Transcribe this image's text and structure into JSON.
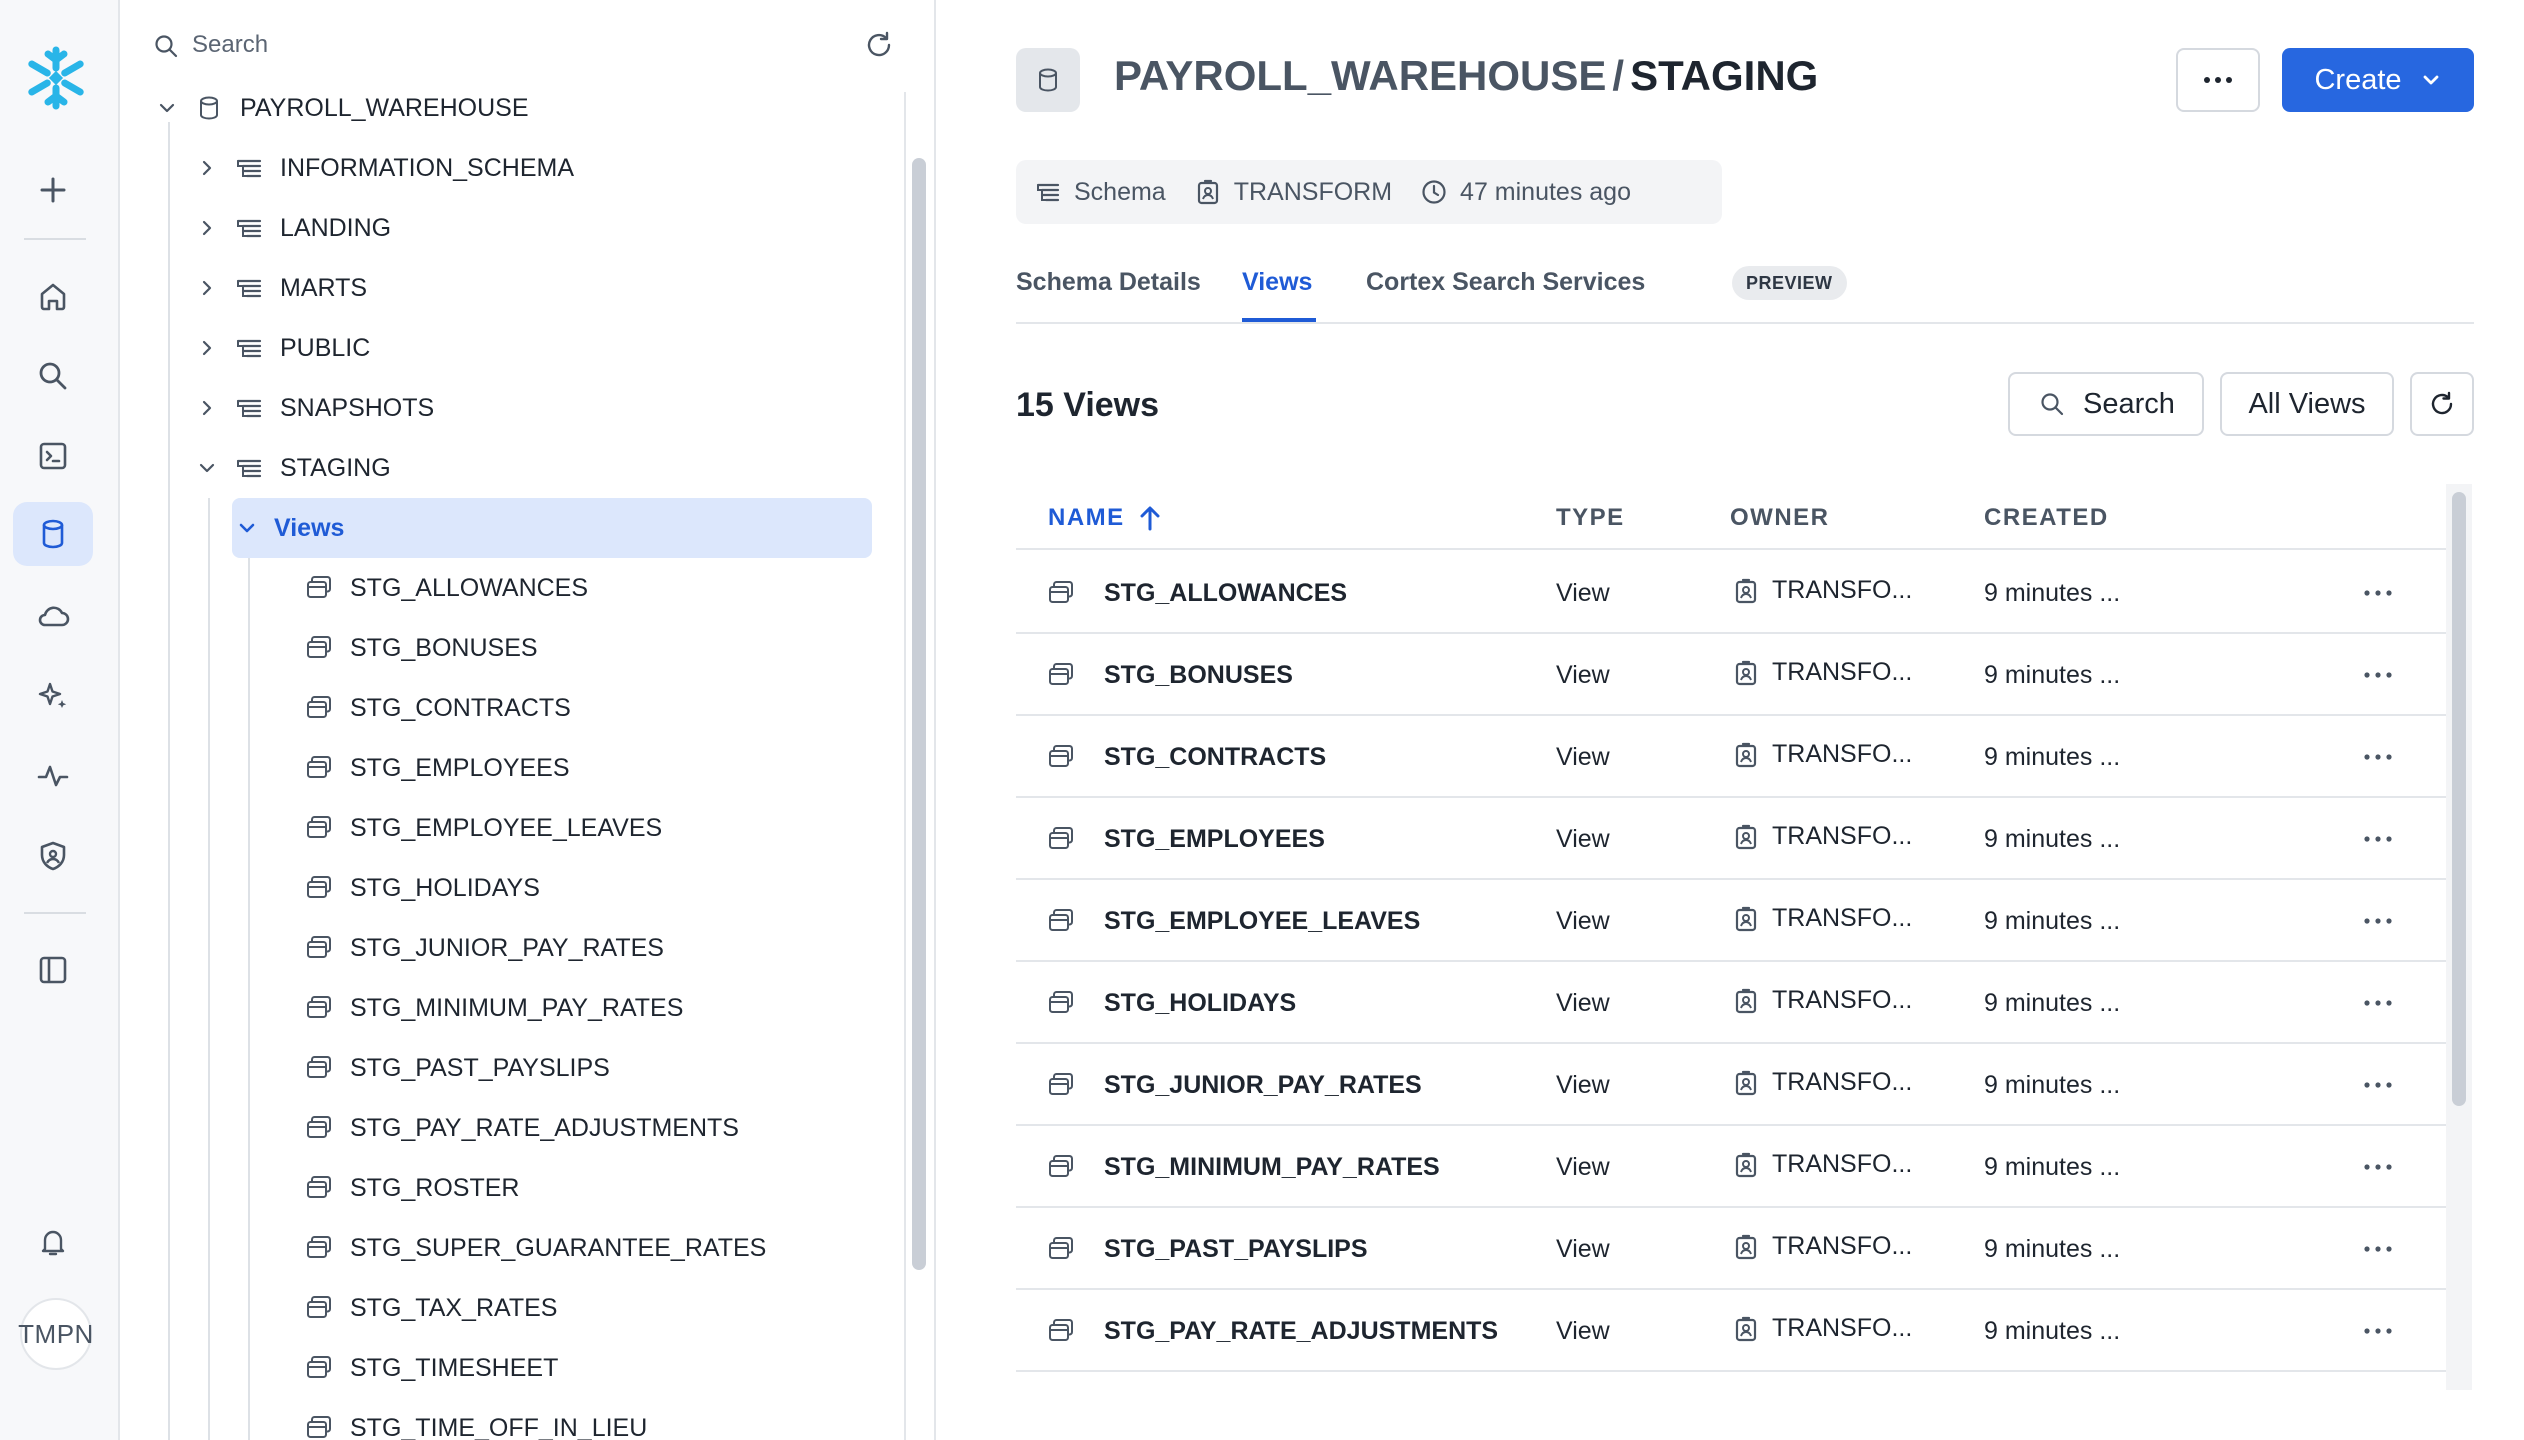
{
  "rail": {
    "avatar_initials": "TMPN",
    "items": [
      "add-icon",
      "home-icon",
      "search-icon",
      "worksheet-icon",
      "data-icon",
      "cloud-icon",
      "ai-sparkle-icon",
      "activity-icon",
      "shield-icon",
      "panel-toggle-icon",
      "bell-icon"
    ],
    "active": "data-icon"
  },
  "explorer": {
    "search_placeholder": "Search",
    "database": "PAYROLL_WAREHOUSE",
    "schemas": [
      "INFORMATION_SCHEMA",
      "LANDING",
      "MARTS",
      "PUBLIC",
      "SNAPSHOTS",
      "STAGING"
    ],
    "expanded_schema": "STAGING",
    "folder": "Views",
    "views": [
      "STG_ALLOWANCES",
      "STG_BONUSES",
      "STG_CONTRACTS",
      "STG_EMPLOYEES",
      "STG_EMPLOYEE_LEAVES",
      "STG_HOLIDAYS",
      "STG_JUNIOR_PAY_RATES",
      "STG_MINIMUM_PAY_RATES",
      "STG_PAST_PAYSLIPS",
      "STG_PAY_RATE_ADJUSTMENTS",
      "STG_ROSTER",
      "STG_SUPER_GUARANTEE_RATES",
      "STG_TAX_RATES",
      "STG_TIMESHEET",
      "STG_TIME_OFF_IN_LIEU"
    ]
  },
  "header": {
    "database": "PAYROLL_WAREHOUSE",
    "separator": "/",
    "schema": "STAGING",
    "create_label": "Create"
  },
  "meta": {
    "kind": "Schema",
    "owner": "TRANSFORM",
    "updated": "47 minutes ago"
  },
  "tabs": {
    "items": [
      "Schema Details",
      "Views",
      "Cortex Search Services"
    ],
    "active": "Views",
    "badge": "PREVIEW"
  },
  "toolbar": {
    "count_label": "15 Views",
    "search_label": "Search",
    "filter_label": "All Views"
  },
  "table": {
    "columns": [
      "NAME",
      "TYPE",
      "OWNER",
      "CREATED"
    ],
    "sorted_column": "NAME",
    "rows": [
      {
        "name": "STG_ALLOWANCES",
        "type": "View",
        "owner": "TRANSFO...",
        "created": "9 minutes ..."
      },
      {
        "name": "STG_BONUSES",
        "type": "View",
        "owner": "TRANSFO...",
        "created": "9 minutes ..."
      },
      {
        "name": "STG_CONTRACTS",
        "type": "View",
        "owner": "TRANSFO...",
        "created": "9 minutes ..."
      },
      {
        "name": "STG_EMPLOYEES",
        "type": "View",
        "owner": "TRANSFO...",
        "created": "9 minutes ..."
      },
      {
        "name": "STG_EMPLOYEE_LEAVES",
        "type": "View",
        "owner": "TRANSFO...",
        "created": "9 minutes ..."
      },
      {
        "name": "STG_HOLIDAYS",
        "type": "View",
        "owner": "TRANSFO...",
        "created": "9 minutes ..."
      },
      {
        "name": "STG_JUNIOR_PAY_RATES",
        "type": "View",
        "owner": "TRANSFO...",
        "created": "9 minutes ..."
      },
      {
        "name": "STG_MINIMUM_PAY_RATES",
        "type": "View",
        "owner": "TRANSFO...",
        "created": "9 minutes ..."
      },
      {
        "name": "STG_PAST_PAYSLIPS",
        "type": "View",
        "owner": "TRANSFO...",
        "created": "9 minutes ..."
      },
      {
        "name": "STG_PAY_RATE_ADJUSTMENTS",
        "type": "View",
        "owner": "TRANSFO...",
        "created": "9 minutes ..."
      }
    ]
  },
  "colors": {
    "accent": "#2767e0",
    "selected_bg": "#dce7fc",
    "logo": "#29b5e8"
  }
}
